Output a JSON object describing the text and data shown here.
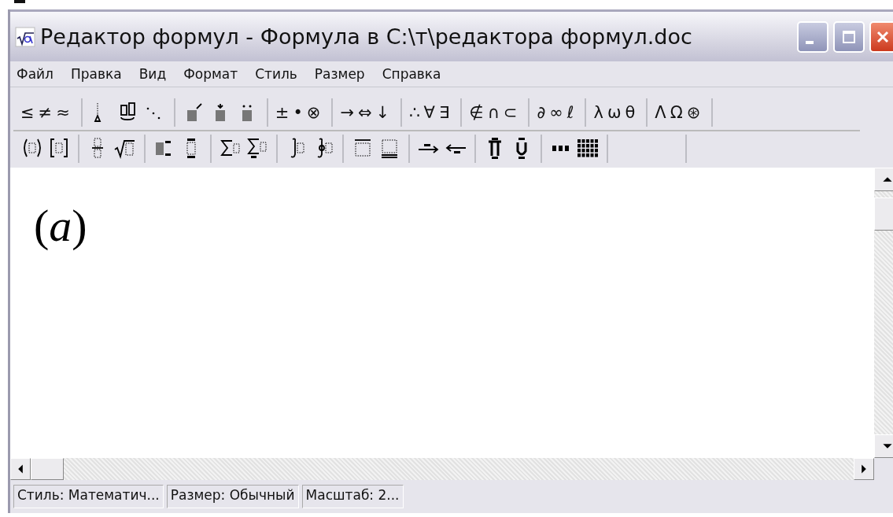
{
  "window": {
    "title": "Редактор формул - Формула в C:\\т\\редактора формул.doc"
  },
  "menu": [
    {
      "label": "Файл"
    },
    {
      "label": "Правка"
    },
    {
      "label": "Вид"
    },
    {
      "label": "Формат"
    },
    {
      "label": "Стиль"
    },
    {
      "label": "Размер"
    },
    {
      "label": "Справка"
    }
  ],
  "toolbar_rows": [
    [
      {
        "kind": "symbols",
        "text": "≤≠≈"
      },
      {
        "kind": "templates"
      },
      {
        "kind": "templates"
      },
      {
        "kind": "symbols",
        "text": "±•⊗"
      },
      {
        "kind": "symbols",
        "text": "→⇔↓"
      },
      {
        "kind": "symbols",
        "text": "∴∀∃"
      },
      {
        "kind": "symbols",
        "text": "∉∩⊂"
      },
      {
        "kind": "symbols",
        "text": "∂∞ℓ"
      },
      {
        "kind": "symbols",
        "text": "λωθ"
      },
      {
        "kind": "symbols",
        "text": "ΛΩ⊛"
      }
    ],
    [
      {
        "kind": "templates"
      },
      {
        "kind": "templates"
      },
      {
        "kind": "templates"
      },
      {
        "kind": "templates"
      },
      {
        "kind": "templates"
      },
      {
        "kind": "templates"
      },
      {
        "kind": "templates"
      },
      {
        "kind": "templates"
      },
      {
        "kind": "templates"
      },
      {
        "kind": "blank"
      }
    ]
  ],
  "document": {
    "formula": "(*a*)"
  },
  "status_bar": [
    {
      "text": "Стиль: Математич..."
    },
    {
      "text": "Размер: Обычный"
    },
    {
      "text": "Масштаб: 2..."
    }
  ]
}
